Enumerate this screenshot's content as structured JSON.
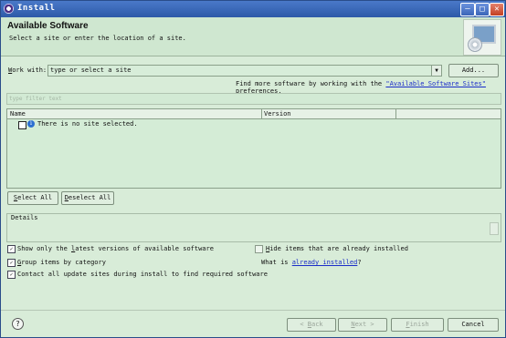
{
  "window": {
    "title": "Install"
  },
  "header": {
    "title": "Available Software",
    "subtitle": "Select a site or enter the location of a site."
  },
  "work_with": {
    "label_underlined": "W",
    "label_rest": "ork with:",
    "placeholder": "type or select a site",
    "add_button": "Add..."
  },
  "find_more": {
    "prefix": "Find more software by working with the ",
    "link": "\"Available Software Sites\"",
    "suffix": " preferences."
  },
  "filter": {
    "placeholder": "type filter text"
  },
  "table": {
    "columns": [
      "Name",
      "Version"
    ],
    "rows": [
      {
        "name": "There is no site selected.",
        "version": ""
      }
    ]
  },
  "buttons": {
    "select_all_u": "S",
    "select_all_rest": "elect All",
    "deselect_all_u": "D",
    "deselect_all_rest": "eselect All"
  },
  "details": {
    "label": "Details"
  },
  "options": {
    "show_latest_a": "Show only the ",
    "show_latest_u": "l",
    "show_latest_b": "atest versions of available software",
    "group_u": "G",
    "group_rest": "roup items by category",
    "contact": "Contact all update sites during install to find required software",
    "hide_u": "H",
    "hide_rest": "ide items that are already installed",
    "what_is_prefix": "What is ",
    "what_is_link": "already installed",
    "what_is_suffix": "?"
  },
  "footer": {
    "back": "< Back",
    "back_u": "B",
    "next": "Next >",
    "next_u": "N",
    "finish": "Finish",
    "finish_u": "F",
    "cancel": "Cancel"
  }
}
